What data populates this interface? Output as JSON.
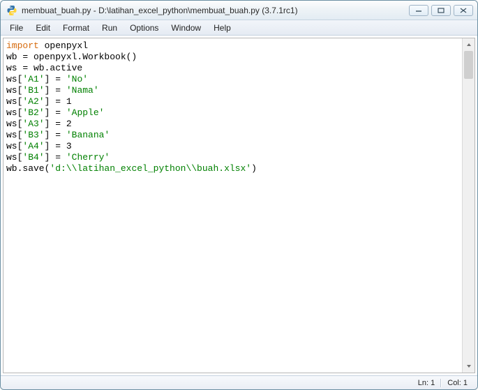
{
  "window": {
    "title": "membuat_buah.py - D:\\latihan_excel_python\\membuat_buah.py (3.7.1rc1)"
  },
  "menu": {
    "file": "File",
    "edit": "Edit",
    "format": "Format",
    "run": "Run",
    "options": "Options",
    "window": "Window",
    "help": "Help"
  },
  "code": {
    "lines": [
      {
        "t": [
          {
            "c": "kw",
            "v": "import"
          },
          {
            "c": "",
            "v": " openpyxl"
          }
        ]
      },
      {
        "t": [
          {
            "c": "",
            "v": "wb = openpyxl.Workbook()"
          }
        ]
      },
      {
        "t": [
          {
            "c": "",
            "v": "ws = wb.active"
          }
        ]
      },
      {
        "t": [
          {
            "c": "",
            "v": "ws["
          },
          {
            "c": "str",
            "v": "'A1'"
          },
          {
            "c": "",
            "v": "] = "
          },
          {
            "c": "str",
            "v": "'No'"
          }
        ]
      },
      {
        "t": [
          {
            "c": "",
            "v": "ws["
          },
          {
            "c": "str",
            "v": "'B1'"
          },
          {
            "c": "",
            "v": "] = "
          },
          {
            "c": "str",
            "v": "'Nama'"
          }
        ]
      },
      {
        "t": [
          {
            "c": "",
            "v": "ws["
          },
          {
            "c": "str",
            "v": "'A2'"
          },
          {
            "c": "",
            "v": "] = 1"
          }
        ]
      },
      {
        "t": [
          {
            "c": "",
            "v": "ws["
          },
          {
            "c": "str",
            "v": "'B2'"
          },
          {
            "c": "",
            "v": "] = "
          },
          {
            "c": "str",
            "v": "'Apple'"
          }
        ]
      },
      {
        "t": [
          {
            "c": "",
            "v": "ws["
          },
          {
            "c": "str",
            "v": "'A3'"
          },
          {
            "c": "",
            "v": "] = 2"
          }
        ]
      },
      {
        "t": [
          {
            "c": "",
            "v": "ws["
          },
          {
            "c": "str",
            "v": "'B3'"
          },
          {
            "c": "",
            "v": "] = "
          },
          {
            "c": "str",
            "v": "'Banana'"
          }
        ]
      },
      {
        "t": [
          {
            "c": "",
            "v": "ws["
          },
          {
            "c": "str",
            "v": "'A4'"
          },
          {
            "c": "",
            "v": "] = 3"
          }
        ]
      },
      {
        "t": [
          {
            "c": "",
            "v": "ws["
          },
          {
            "c": "str",
            "v": "'B4'"
          },
          {
            "c": "",
            "v": "] = "
          },
          {
            "c": "str",
            "v": "'Cherry'"
          }
        ]
      },
      {
        "t": [
          {
            "c": "",
            "v": "wb.save("
          },
          {
            "c": "str",
            "v": "'d:\\\\latihan_excel_python\\\\buah.xlsx'"
          },
          {
            "c": "",
            "v": ")"
          }
        ]
      }
    ]
  },
  "status": {
    "ln": "Ln: 1",
    "col": "Col: 1"
  }
}
